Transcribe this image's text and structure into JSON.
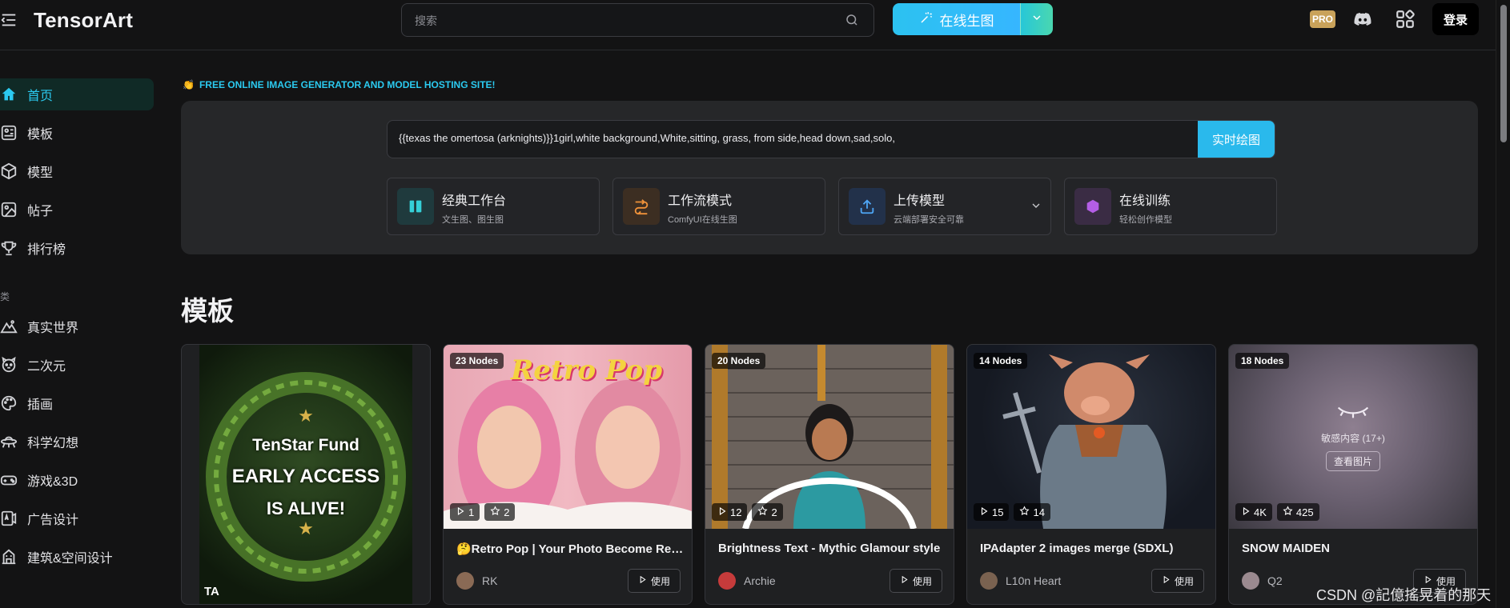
{
  "header": {
    "logo": "TensorArt",
    "search_placeholder": "搜索",
    "generate_label": "在线生图",
    "pro_badge": "PRO",
    "login_label": "登录"
  },
  "sidebar": {
    "items": [
      {
        "label": "首页",
        "icon": "home-icon",
        "active": true
      },
      {
        "label": "模板",
        "icon": "template-icon"
      },
      {
        "label": "模型",
        "icon": "cube-icon"
      },
      {
        "label": "帖子",
        "icon": "image-icon"
      },
      {
        "label": "排行榜",
        "icon": "trophy-icon"
      }
    ],
    "section_label": "类",
    "categories": [
      {
        "label": "真实世界",
        "icon": "mountain-icon"
      },
      {
        "label": "二次元",
        "icon": "anime-face-icon"
      },
      {
        "label": "插画",
        "icon": "palette-icon"
      },
      {
        "label": "科学幻想",
        "icon": "ufo-icon"
      },
      {
        "label": "游戏&3D",
        "icon": "gamepad-icon"
      },
      {
        "label": "广告设计",
        "icon": "ad-icon"
      },
      {
        "label": "建筑&空间设计",
        "icon": "building-icon"
      }
    ]
  },
  "hero": {
    "tagline": "FREE ONLINE IMAGE GENERATOR AND MODEL HOSTING SITE!",
    "prompt_text": "{{texas the omertosa (arknights)}}1girl,white background,White,sitting, grass, from side,head down,sad,solo,",
    "realtime_label": "实时绘图",
    "features": [
      {
        "title": "经典工作台",
        "subtitle": "文生图、图生图",
        "icon": "workbench-icon",
        "color": "#35d0d8",
        "bg": "#1f3a3d"
      },
      {
        "title": "工作流模式",
        "subtitle": "ComfyUI在线生图",
        "icon": "workflow-icon",
        "color": "#f0923a",
        "bg": "#3c2e22"
      },
      {
        "title": "上传模型",
        "subtitle": "云端部署安全可靠",
        "icon": "upload-icon",
        "color": "#4ea6f5",
        "bg": "#22314a"
      },
      {
        "title": "在线训练",
        "subtitle": "轻松创作模型",
        "icon": "training-icon",
        "color": "#b45ee6",
        "bg": "#3a2c44"
      }
    ]
  },
  "templates": {
    "section_title": "模板",
    "cards": [
      {
        "promo_lines": [
          "TenStar Fund",
          "EARLY ACCESS",
          "IS ALIVE!"
        ],
        "corner": "TA"
      },
      {
        "nodes": "23 Nodes",
        "overlay": "Retro Pop",
        "runs": "1",
        "stars": "2",
        "title": "🤔Retro Pop | Your Photo Become Retro Pop Art",
        "author": "RK",
        "use_label": "使用"
      },
      {
        "nodes": "20 Nodes",
        "runs": "12",
        "stars": "2",
        "title": "Brightness Text - Mythic Glamour style",
        "author": "Archie",
        "use_label": "使用"
      },
      {
        "nodes": "14 Nodes",
        "runs": "15",
        "stars": "14",
        "title": "IPAdapter 2 images merge (SDXL)",
        "author": "L10n Heart",
        "use_label": "使用"
      },
      {
        "nodes": "18 Nodes",
        "sensitive_text": "敏感内容 (17+)",
        "view_label": "查看图片",
        "runs": "4K",
        "stars": "425",
        "title": "SNOW MAIDEN",
        "author": "Q2",
        "use_label": "使用"
      }
    ]
  },
  "watermark": "CSDN @記億搖晃着的那天"
}
